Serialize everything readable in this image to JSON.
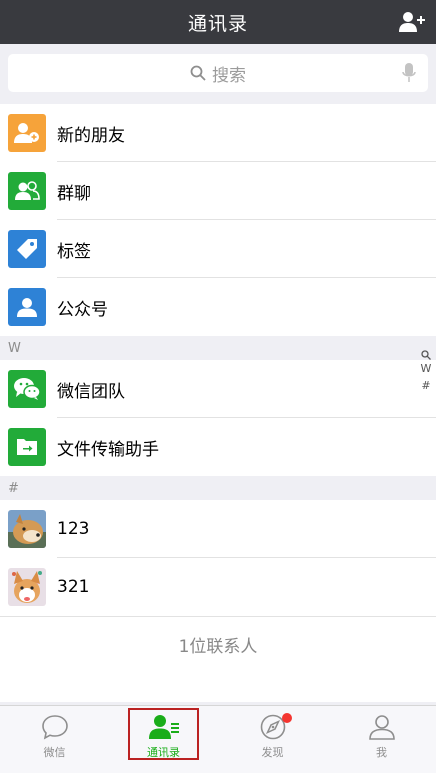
{
  "header": {
    "title": "通讯录",
    "add_icon": "add-contact-icon"
  },
  "search": {
    "placeholder": "搜索"
  },
  "top_items": [
    {
      "label": "新的朋友",
      "color": "#f6a33a",
      "icon": "new-friend-icon"
    },
    {
      "label": "群聊",
      "color": "#22ab39",
      "icon": "group-chat-icon"
    },
    {
      "label": "标签",
      "color": "#2e82d6",
      "icon": "tag-icon"
    },
    {
      "label": "公众号",
      "color": "#2e82d6",
      "icon": "official-account-icon"
    }
  ],
  "sections": [
    {
      "letter": "W",
      "items": [
        {
          "label": "微信团队",
          "color": "#22ab39",
          "icon": "wechat-team-icon"
        },
        {
          "label": "文件传输助手",
          "color": "#22ab39",
          "icon": "file-transfer-icon"
        }
      ]
    },
    {
      "letter": "#",
      "items": [
        {
          "label": "123",
          "icon": "avatar-shiba"
        },
        {
          "label": "321",
          "icon": "avatar-corgi"
        }
      ]
    }
  ],
  "contact_count": "1位联系人",
  "index_bar": [
    "W",
    "#"
  ],
  "tabs": [
    {
      "label": "微信",
      "icon": "chat-icon",
      "active": false
    },
    {
      "label": "通讯录",
      "icon": "contacts-icon",
      "active": true
    },
    {
      "label": "发现",
      "icon": "discover-icon",
      "active": false,
      "badge": true
    },
    {
      "label": "我",
      "icon": "me-icon",
      "active": false
    }
  ]
}
